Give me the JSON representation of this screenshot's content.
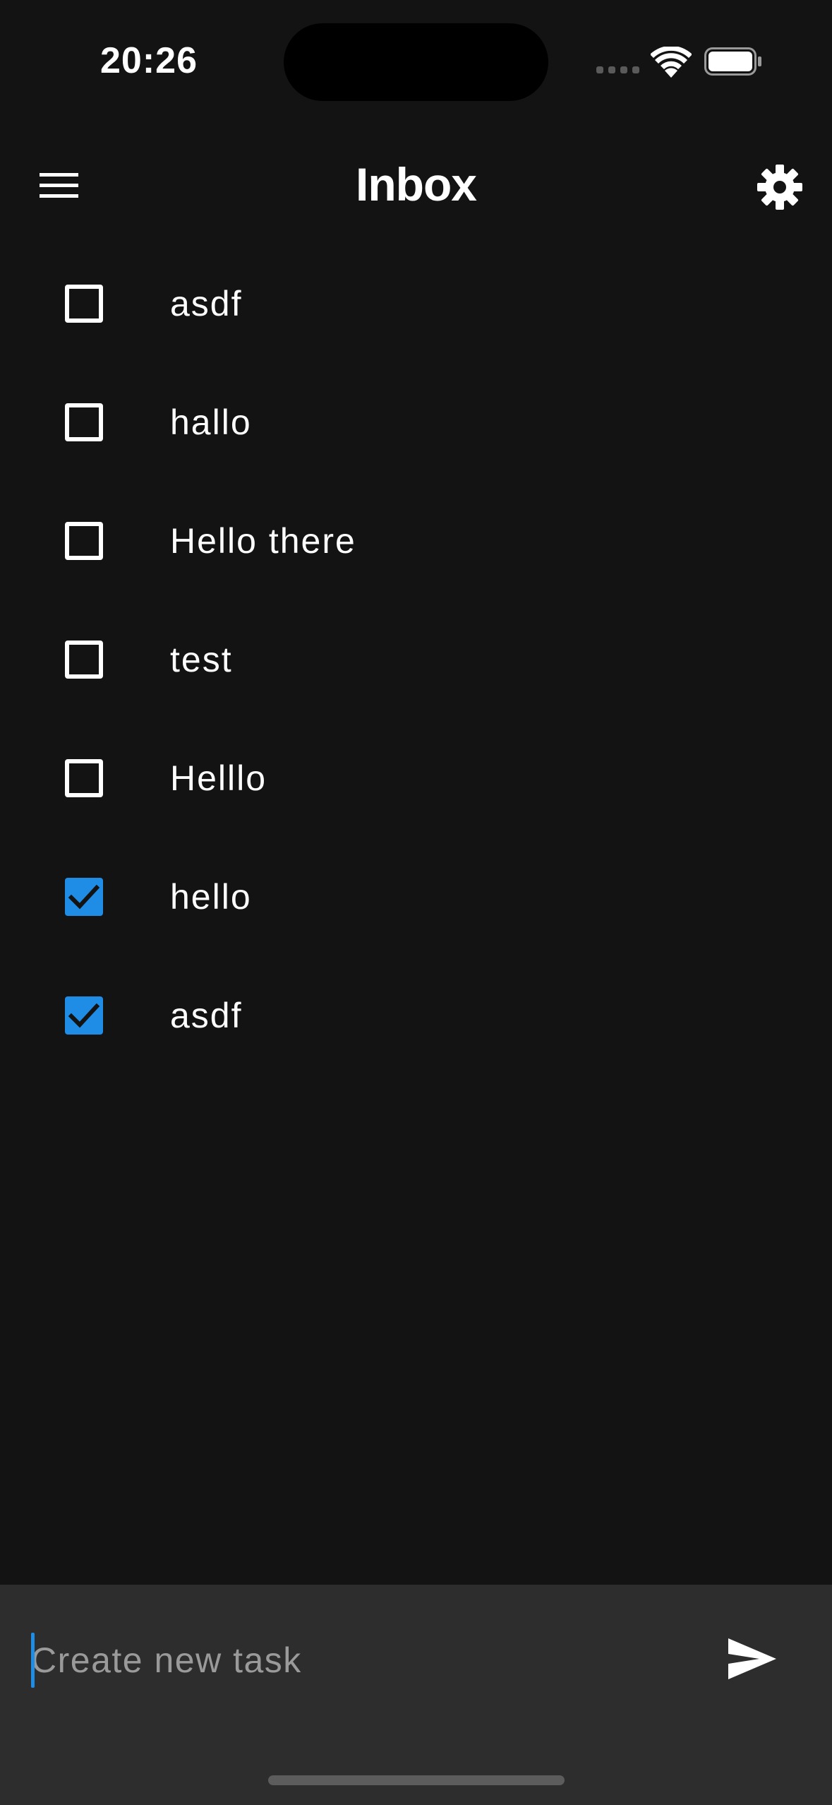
{
  "status_bar": {
    "time": "20:26",
    "signal_icon": "cellular-signal-icon",
    "wifi_icon": "wifi-icon",
    "battery_icon": "battery-icon"
  },
  "header": {
    "title": "Inbox",
    "menu_icon": "hamburger-menu-icon",
    "settings_icon": "gear-icon"
  },
  "tasks": [
    {
      "label": "asdf",
      "checked": false
    },
    {
      "label": "hallo",
      "checked": false
    },
    {
      "label": "Hello there",
      "checked": false
    },
    {
      "label": "test",
      "checked": false
    },
    {
      "label": "Helllo",
      "checked": false
    },
    {
      "label": "hello",
      "checked": true
    },
    {
      "label": "asdf",
      "checked": true
    }
  ],
  "composer": {
    "value": "",
    "placeholder": "Create new task",
    "send_icon": "send-icon"
  },
  "colors": {
    "background": "#131313",
    "composer_background": "#2d2d2d",
    "accent": "#1f8ce6",
    "text": "#ffffff",
    "placeholder": "#9a9a9a"
  }
}
